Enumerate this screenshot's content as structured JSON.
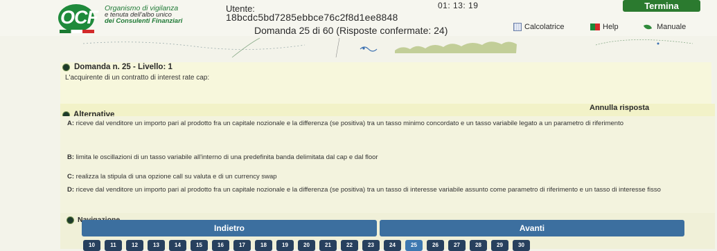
{
  "header": {
    "logo_text": "OCF",
    "org_line1": "Organismo di vigilanza",
    "org_line2": "e tenuta dell'albo unico",
    "org_line3": "dei Consulenti Finanziari",
    "user_label": "Utente:",
    "user_id": "18bcdc5bd7285ebbce76c2f8d1ee8848",
    "timer": "01: 13: 19",
    "termina_label": "Termina",
    "domanda_status": "Domanda 25 di 60 (Risposte confermate: 24)",
    "tools": [
      {
        "label": "Calcolatrice",
        "icon": "calculator-icon"
      },
      {
        "label": "Help",
        "icon": "flag-icon"
      },
      {
        "label": "Manuale",
        "icon": "leaf-icon"
      }
    ]
  },
  "question": {
    "heading": "Domanda n. 25 - Livello: 1",
    "text": "L'acquirente di un contratto di interest rate cap:"
  },
  "alternatives": {
    "heading": "Alternative",
    "annulla_label": "Annulla risposta",
    "items": [
      {
        "letter": "A:",
        "text": "riceve dal venditore un importo pari al prodotto fra un capitale nozionale e la differenza (se positiva) tra un tasso minimo concordato e un tasso variabile legato a un parametro di riferimento"
      },
      {
        "letter": "B:",
        "text": "limita le oscillazioni di un tasso variabile all'interno di una predefinita banda delimitata dal cap e dal floor"
      },
      {
        "letter": "C:",
        "text": "realizza la stipula di una opzione call su valuta e di un currency swap"
      },
      {
        "letter": "D:",
        "text": "riceve dal venditore un importo pari al prodotto fra un capitale nozionale e la differenza (se positiva) tra un tasso di interesse variabile assunto come parametro di riferimento e un tasso di interesse fisso"
      }
    ]
  },
  "navigation": {
    "heading": "Navigazione",
    "prev_label": "Indietro",
    "next_label": "Avanti",
    "current_page": "25",
    "pages": [
      "10",
      "11",
      "12",
      "13",
      "14",
      "15",
      "16",
      "17",
      "18",
      "19",
      "20",
      "21",
      "22",
      "23",
      "24",
      "25",
      "26",
      "27",
      "28",
      "29",
      "30"
    ]
  },
  "colors": {
    "termina_bg": "#2b7a2f",
    "button_bg": "#3c6f9f",
    "page_bg": "#27405e",
    "page_current_bg": "#3d78b0",
    "logo_green": "#1f8a3b"
  }
}
